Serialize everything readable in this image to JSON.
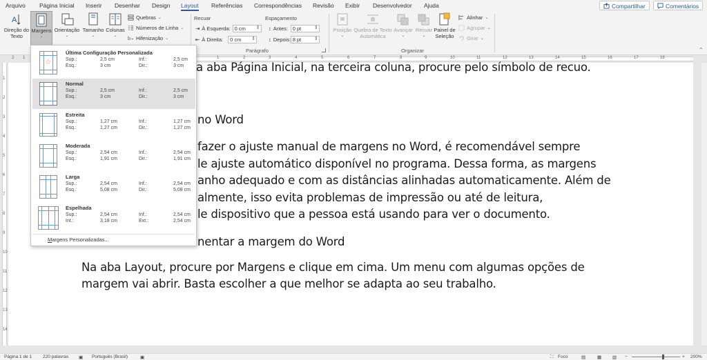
{
  "menu": {
    "tabs": [
      "Arquivo",
      "Página Inicial",
      "Inserir",
      "Desenhar",
      "Design",
      "Layout",
      "Referências",
      "Correspondências",
      "Revisão",
      "Exibir",
      "Desenvolvedor",
      "Ajuda"
    ],
    "active_tab": "Layout",
    "share_label": "Compartilhar",
    "comments_label": "Comentários"
  },
  "ribbon": {
    "text_direction": [
      "Direção do",
      "Texto"
    ],
    "margins": "Margens",
    "orientation": "Orientação",
    "size": "Tamanho",
    "columns": "Colunas",
    "breaks": "Quebras",
    "line_numbers": "Números de Linha",
    "hyphenation": "Hifenização",
    "indent_title": "Recuar",
    "indent_left_label": "À Esquerda:",
    "indent_left_value": "0 cm",
    "indent_right_label": "À Direita:",
    "indent_right_value": "0 cm",
    "spacing_title": "Espaçamento",
    "spacing_before_label": "Antes:",
    "spacing_before_value": "0 pt",
    "spacing_after_label": "Depois:",
    "spacing_after_value": "8 pt",
    "paragraph_group": "Parágrafo",
    "position": "Posição",
    "wrap_text": [
      "Quebra de Texto",
      "Automática"
    ],
    "bring_forward": "Avançar",
    "send_backward": "Recuar",
    "selection_pane": [
      "Painel de",
      "Seleção"
    ],
    "align": "Alinhar",
    "group": "Agrupar",
    "rotate": "Girar",
    "arrange_group": "Organizar"
  },
  "margin_menu": {
    "presets": [
      {
        "name": "Última Configuração Personalizada",
        "l1a": "Sup.:",
        "v1a": "2,5 cm",
        "l1b": "Inf.:",
        "v1b": "2,5 cm",
        "l2a": "Esq.:",
        "v2a": "3 cm",
        "l2b": "Dir.:",
        "v2b": "3 cm"
      },
      {
        "name": "Normal",
        "l1a": "Sup.:",
        "v1a": "2,5 cm",
        "l1b": "Inf.:",
        "v1b": "2,5 cm",
        "l2a": "Esq.:",
        "v2a": "3 cm",
        "l2b": "Dir.:",
        "v2b": "3 cm"
      },
      {
        "name": "Estreita",
        "l1a": "Sup.:",
        "v1a": "1,27 cm",
        "l1b": "Inf.:",
        "v1b": "1,27 cm",
        "l2a": "Esq.:",
        "v2a": "1,27 cm",
        "l2b": "Dir.:",
        "v2b": "1,27 cm"
      },
      {
        "name": "Moderada",
        "l1a": "Sup.:",
        "v1a": "2,54 cm",
        "l1b": "Inf.:",
        "v1b": "2,54 cm",
        "l2a": "Esq.:",
        "v2a": "1,91 cm",
        "l2b": "Dir.:",
        "v2b": "1,91 cm"
      },
      {
        "name": "Larga",
        "l1a": "Sup.:",
        "v1a": "2,54 cm",
        "l1b": "Inf.:",
        "v1b": "2,54 cm",
        "l2a": "Esq.:",
        "v2a": "5,08 cm",
        "l2b": "Dir.:",
        "v2b": "5,08 cm"
      },
      {
        "name": "Espelhada",
        "l1a": "Sup.:",
        "v1a": "2,54 cm",
        "l1b": "Inf.:",
        "v1b": "2,54 cm",
        "l2a": "Int.:",
        "v2a": "3,18 cm",
        "l2b": "Ext.:",
        "v2b": "2,54 cm"
      }
    ],
    "custom_label_u": "M",
    "custom_label_rest": "argens Personalizadas..."
  },
  "document": {
    "lines": [
      "a aba Página Inicial, na terceira coluna, procure pelo símbolo de recuo.",
      "no Word",
      "fazer o ajuste manual de margens no Word, é recomendável sempre",
      "le ajuste automático disponível no programa. Dessa forma, as margens",
      "anho adequado e com as distâncias alinhadas automaticamente. Além de",
      "almente, isso evita problemas de impressão ou até de leitura,",
      "le dispositivo que a pessoa está usando para ver o documento.",
      "nentar a margem do Word",
      "Na aba Layout, procure por Margens e clique em cima. Um menu com algumas opções de",
      "margem vai abrir. Basta escolher a que melhor se adapta ao seu trabalho."
    ]
  },
  "ruler": {
    "h_numbers": [
      "2",
      "1",
      "1",
      "2",
      "3",
      "4",
      "5",
      "6",
      "7",
      "8",
      "9",
      "10",
      "11",
      "12",
      "13",
      "14",
      "15",
      "16",
      "17",
      "18"
    ],
    "v_numbers": [
      "1",
      "2",
      "3",
      "4",
      "5",
      "6",
      "7",
      "8",
      "9",
      "10",
      "11",
      "12",
      "13",
      "14",
      "15"
    ]
  },
  "status": {
    "page": "Página 1 de 1",
    "words": "220 palavras",
    "language": "Português (Brasil)",
    "focus": "Foco",
    "zoom": "200%"
  },
  "colors": {
    "accent": "#2b579a",
    "margin_guides": "#6b9bd1",
    "selected_item": "#e1e1e1"
  }
}
